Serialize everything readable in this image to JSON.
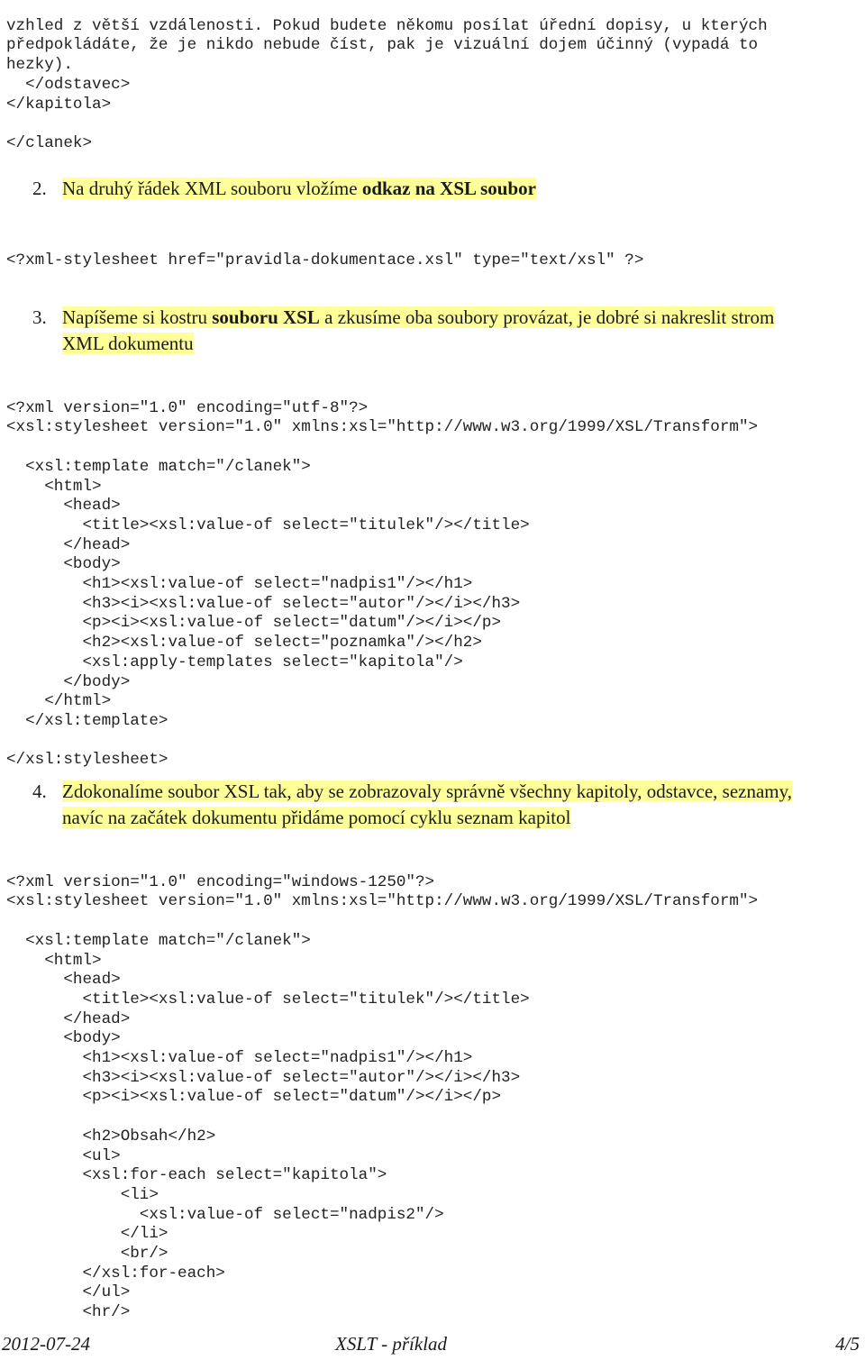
{
  "intro_block": {
    "lines": [
      "vzhled z větší vzdálenosti. Pokud budete někomu posílat úřední dopisy, u kterých",
      "předpokládáte, že je nikdo nebude číst, pak je vizuální dojem účinný (vypadá to",
      "hezky).",
      "  </odstavec>",
      "</kapitola>",
      "",
      "</clanek>"
    ]
  },
  "steps": [
    {
      "number": "2.",
      "text_before": "Na druhý řádek XML souboru vložíme ",
      "bold": "odkaz na XSL  soubor",
      "text_after": "",
      "code": [
        "<?xml-stylesheet href=\"pravidla-dokumentace.xsl\" type=\"text/xsl\" ?>"
      ]
    },
    {
      "number": "3.",
      "text_before": "Napíšeme si kostru ",
      "bold": "souboru XSL",
      "text_after": " a zkusíme oba soubory provázat, je dobré si nakreslit strom",
      "text_line2": "XML dokumentu",
      "code": [
        "<?xml version=\"1.0\" encoding=\"utf-8\"?>",
        "<xsl:stylesheet version=\"1.0\" xmlns:xsl=\"http://www.w3.org/1999/XSL/Transform\">",
        "",
        "  <xsl:template match=\"/clanek\">",
        "    <html>",
        "      <head>",
        "        <title><xsl:value-of select=\"titulek\"/></title>",
        "      </head>",
        "      <body>",
        "        <h1><xsl:value-of select=\"nadpis1\"/></h1>",
        "        <h3><i><xsl:value-of select=\"autor\"/></i></h3>",
        "        <p><i><xsl:value-of select=\"datum\"/></i></p>",
        "        <h2><xsl:value-of select=\"poznamka\"/></h2>",
        "        <xsl:apply-templates select=\"kapitola\"/>",
        "      </body>",
        "    </html>",
        "  </xsl:template>",
        "",
        "</xsl:stylesheet>"
      ]
    },
    {
      "number": "4.",
      "text_line1": "Zdokonalíme soubor XSL tak, aby se zobrazovaly správně všechny kapitoly, odstavce, seznamy,",
      "text_line2": "navíc na začátek dokumentu přidáme pomocí cyklu seznam kapitol",
      "code": [
        "<?xml version=\"1.0\" encoding=\"windows-1250\"?>",
        "<xsl:stylesheet version=\"1.0\" xmlns:xsl=\"http://www.w3.org/1999/XSL/Transform\">",
        "",
        "  <xsl:template match=\"/clanek\">",
        "    <html>",
        "      <head>",
        "        <title><xsl:value-of select=\"titulek\"/></title>",
        "      </head>",
        "      <body>",
        "        <h1><xsl:value-of select=\"nadpis1\"/></h1>",
        "        <h3><i><xsl:value-of select=\"autor\"/></i></h3>",
        "        <p><i><xsl:value-of select=\"datum\"/></i></p>",
        "",
        "        <h2>Obsah</h2>",
        "        <ul>",
        "        <xsl:for-each select=\"kapitola\">",
        "            <li>",
        "              <xsl:value-of select=\"nadpis2\"/>",
        "            </li>",
        "            <br/>",
        "        </xsl:for-each>",
        "        </ul>",
        "        <hr/>"
      ]
    }
  ],
  "footer": {
    "date": "2012-07-24",
    "title": "XSLT - příklad",
    "page": "4/5"
  }
}
